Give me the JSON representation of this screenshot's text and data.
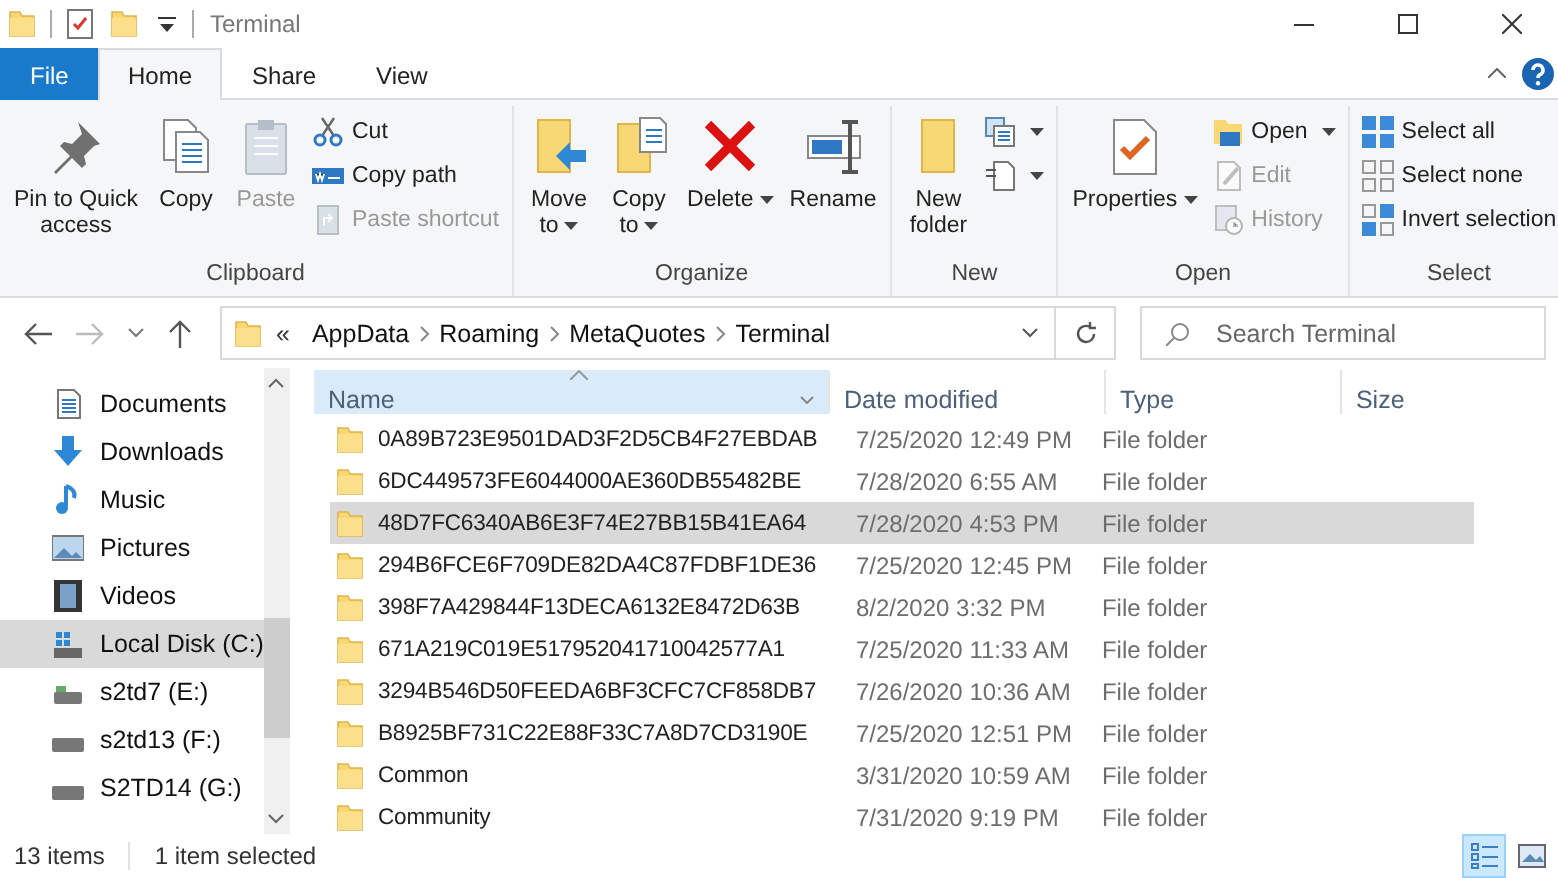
{
  "window": {
    "title": "Terminal"
  },
  "ribbon_tabs": [
    {
      "label": "File",
      "kind": "file",
      "selected": false
    },
    {
      "label": "Home",
      "kind": "tab",
      "selected": true
    },
    {
      "label": "Share",
      "kind": "tab",
      "selected": false
    },
    {
      "label": "View",
      "kind": "tab",
      "selected": false
    }
  ],
  "ribbon_groups": [
    {
      "label": "Clipboard",
      "items": [
        {
          "kind": "large",
          "label": "Pin to Quick\naccess",
          "disabled": false
        },
        {
          "kind": "large",
          "label": "Copy",
          "disabled": false
        },
        {
          "kind": "large",
          "label": "Paste",
          "disabled": true
        },
        {
          "kind": "small",
          "label": "Cut",
          "disabled": false
        },
        {
          "kind": "small",
          "label": "Copy path",
          "disabled": false
        },
        {
          "kind": "small",
          "label": "Paste shortcut",
          "disabled": true
        }
      ]
    },
    {
      "label": "Organize",
      "items": [
        {
          "kind": "large",
          "label": "Move\nto",
          "dropdown": true,
          "disabled": false
        },
        {
          "kind": "large",
          "label": "Copy\nto",
          "dropdown": true,
          "disabled": false
        },
        {
          "kind": "large",
          "label": "Delete",
          "dropdown": true,
          "disabled": false
        },
        {
          "kind": "large",
          "label": "Rename",
          "disabled": false
        }
      ]
    },
    {
      "label": "New",
      "items": [
        {
          "kind": "large",
          "label": "New\nfolder",
          "disabled": false
        },
        {
          "kind": "small",
          "dropdown": true
        },
        {
          "kind": "small",
          "dropdown": true
        }
      ]
    },
    {
      "label": "Open",
      "items": [
        {
          "kind": "large",
          "label": "Properties",
          "dropdown": true,
          "disabled": false
        },
        {
          "kind": "small",
          "label": "Open",
          "dropdown": true,
          "disabled": false
        },
        {
          "kind": "small",
          "label": "Edit",
          "disabled": true
        },
        {
          "kind": "small",
          "label": "History",
          "disabled": true
        }
      ]
    },
    {
      "label": "Select",
      "items": [
        {
          "kind": "small",
          "label": "Select all",
          "disabled": false
        },
        {
          "kind": "small",
          "label": "Select none",
          "disabled": false
        },
        {
          "kind": "small",
          "label": "Invert selection",
          "disabled": false
        }
      ]
    }
  ],
  "address_bar": {
    "overflow": "«",
    "path": [
      "AppData",
      "Roaming",
      "MetaQuotes",
      "Terminal"
    ]
  },
  "search": {
    "placeholder": "Search Terminal"
  },
  "nav_items": [
    {
      "label": "Documents",
      "selected": false
    },
    {
      "label": "Downloads",
      "selected": false
    },
    {
      "label": "Music",
      "selected": false
    },
    {
      "label": "Pictures",
      "selected": false
    },
    {
      "label": "Videos",
      "selected": false
    },
    {
      "label": "Local Disk (C:)",
      "selected": true
    },
    {
      "label": "s2td7 (E:)",
      "selected": false
    },
    {
      "label": "s2td13 (F:)",
      "selected": false
    },
    {
      "label": "S2TD14 (G:)",
      "selected": false
    }
  ],
  "columns": [
    {
      "label": "Name",
      "sorted": true
    },
    {
      "label": "Date modified",
      "sorted": false
    },
    {
      "label": "Type",
      "sorted": false
    },
    {
      "label": "Size",
      "sorted": false
    }
  ],
  "files": [
    {
      "name": "0A89B723E9501DAD3F2D5CB4F27EBDAB",
      "date": "7/25/2020 12:49 PM",
      "type": "File folder",
      "selected": false
    },
    {
      "name": "6DC449573FE6044000AE360DB55482BE",
      "date": "7/28/2020 6:55 AM",
      "type": "File folder",
      "selected": false
    },
    {
      "name": "48D7FC6340AB6E3F74E27BB15B41EA64",
      "date": "7/28/2020 4:53 PM",
      "type": "File folder",
      "selected": true
    },
    {
      "name": "294B6FCE6F709DE82DA4C87FDBF1DE36",
      "date": "7/25/2020 12:45 PM",
      "type": "File folder",
      "selected": false
    },
    {
      "name": "398F7A429844F13DECA6132E8472D63B",
      "date": "8/2/2020 3:32 PM",
      "type": "File folder",
      "selected": false
    },
    {
      "name": "671A219C019E517952041710042577A1",
      "date": "7/25/2020 11:33 AM",
      "type": "File folder",
      "selected": false
    },
    {
      "name": "3294B546D50FEEDA6BF3CFC7CF858DB7",
      "date": "7/26/2020 10:36 AM",
      "type": "File folder",
      "selected": false
    },
    {
      "name": "B8925BF731C22E88F33C7A8D7CD3190E",
      "date": "7/25/2020 12:51 PM",
      "type": "File folder",
      "selected": false
    },
    {
      "name": "Common",
      "date": "3/31/2020 10:59 AM",
      "type": "File folder",
      "selected": false
    },
    {
      "name": "Community",
      "date": "7/31/2020 9:19 PM",
      "type": "File folder",
      "selected": false
    }
  ],
  "status_bar": {
    "item_count": "13 items",
    "selection": "1 item selected"
  },
  "view_buttons": [
    {
      "selected": true
    },
    {
      "selected": false
    }
  ]
}
